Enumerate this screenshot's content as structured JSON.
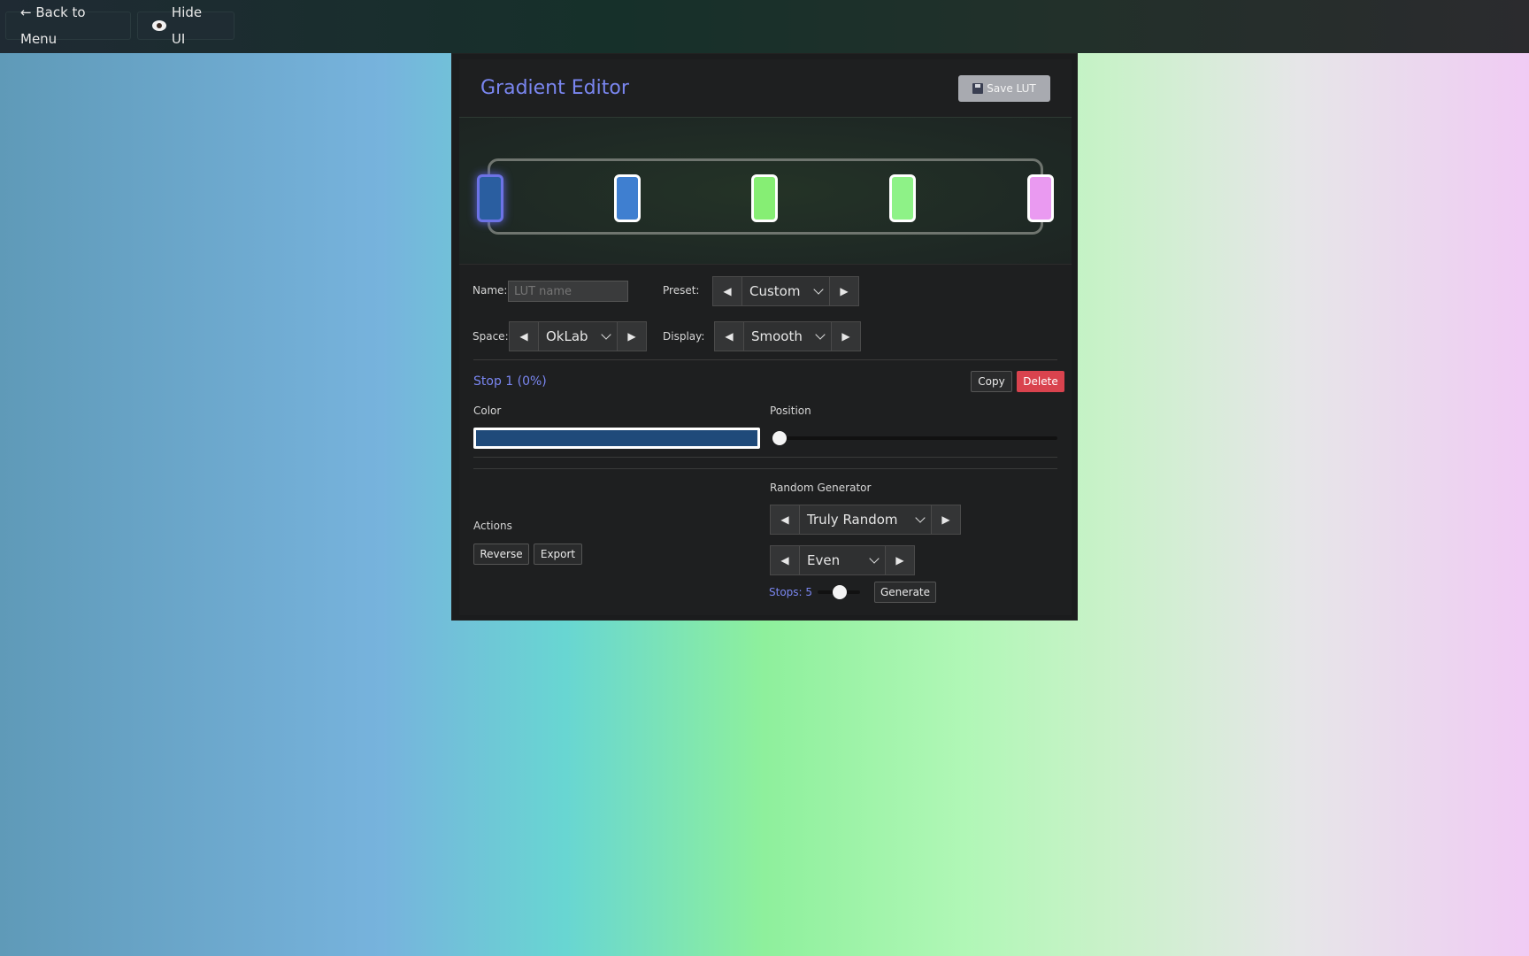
{
  "topbar": {
    "back_label": "← Back to Menu",
    "hide_label": "Hide UI"
  },
  "editor": {
    "title": "Gradient Editor",
    "save_label": "Save LUT",
    "stops": [
      {
        "color": "#2a5ea0",
        "selected": true
      },
      {
        "color": "#3f7fd0",
        "selected": false
      },
      {
        "color": "#86ee74",
        "selected": false
      },
      {
        "color": "#8ef287",
        "selected": false
      },
      {
        "color": "#ea9af1",
        "selected": false
      }
    ],
    "name_label": "Name:",
    "name_placeholder": "LUT name",
    "preset_label": "Preset:",
    "preset_value": "Custom",
    "space_label": "Space:",
    "space_value": "OkLab",
    "display_label": "Display:",
    "display_value": "Smooth",
    "stop_title": "Stop 1 (0%)",
    "copy_label": "Copy",
    "delete_label": "Delete",
    "color_label": "Color",
    "color_value": "#1f4a7a",
    "position_label": "Position",
    "position_value": 0,
    "actions_label": "Actions",
    "reverse_label": "Reverse",
    "export_label": "Export",
    "random_label": "Random Generator",
    "random_mode": "Truly Random",
    "distribution": "Even",
    "stops_label": "Stops: 5",
    "stops_count": 5,
    "generate_label": "Generate"
  }
}
